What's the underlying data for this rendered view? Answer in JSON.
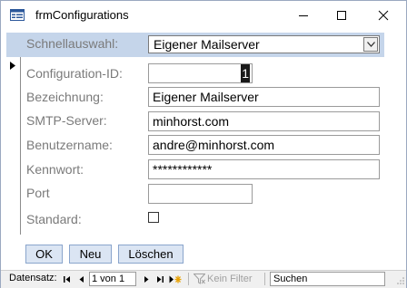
{
  "window": {
    "title": "frmConfigurations",
    "controls": {
      "minimize_icon": "minimize-icon",
      "maximize_icon": "maximize-icon",
      "close_icon": "close-icon"
    }
  },
  "header": {
    "quick_select_label": "Schnellauswahl:",
    "quick_select_value": "Eigener Mailserver",
    "band_color": "#c5d5ea"
  },
  "fields": {
    "configuration_id": {
      "label": "Configuration-ID:",
      "value": "1"
    },
    "bezeichnung": {
      "label": "Bezeichnung:",
      "value": "Eigener Mailserver"
    },
    "smtp_server": {
      "label": "SMTP-Server:",
      "value": "minhorst.com"
    },
    "benutzername": {
      "label": "Benutzername:",
      "value": "andre@minhorst.com"
    },
    "kennwort": {
      "label": "Kennwort:",
      "value": "************"
    },
    "port": {
      "label": "Port",
      "value": ""
    },
    "standard": {
      "label": "Standard:",
      "checked": false
    }
  },
  "buttons": {
    "ok": "OK",
    "neu": "Neu",
    "loeschen": "Löschen"
  },
  "navigation": {
    "label": "Datensatz:",
    "position": "1 von 1",
    "filter": "Kein Filter",
    "search": "Suchen"
  }
}
